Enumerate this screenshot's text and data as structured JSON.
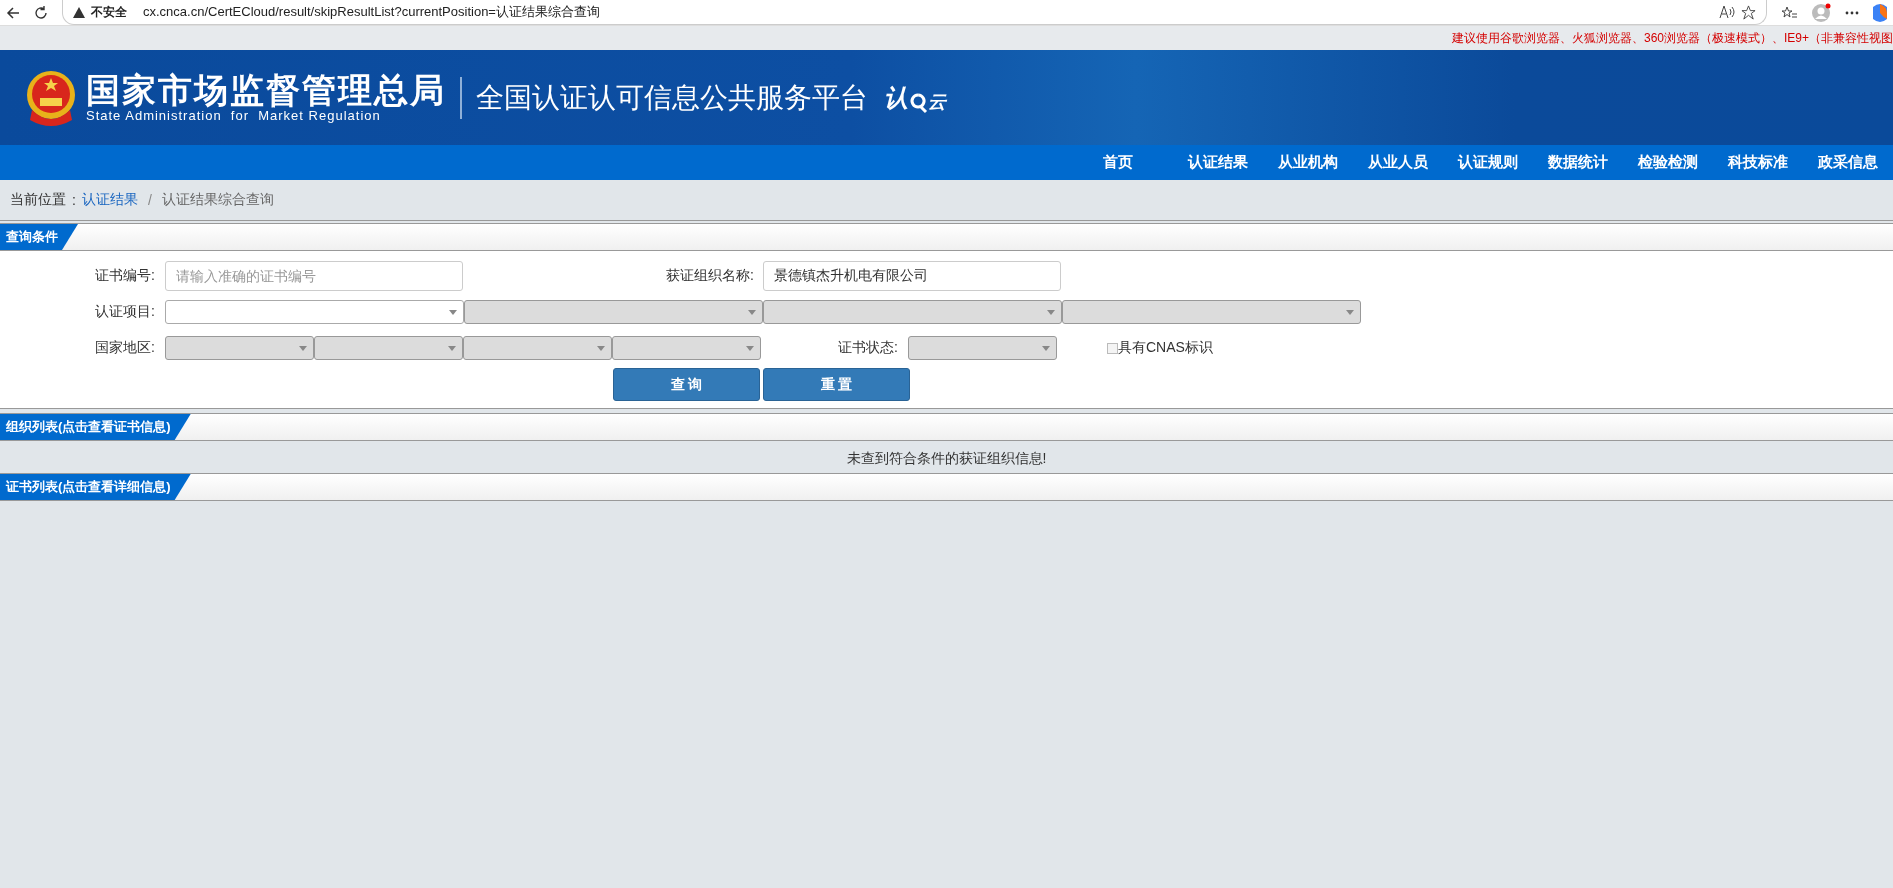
{
  "browser": {
    "security": "不安全",
    "url": "cx.cnca.cn/CertECloud/result/skipResultList?currentPosition=认证结果综合查询"
  },
  "notice": "建议使用谷歌浏览器、火狐浏览器、360浏览器（极速模式）、IE9+（非兼容性视图",
  "header": {
    "org_cn": "国家市场监督管理总局",
    "org_en": "State Administration  for  Market Regulation",
    "platform": "全国认证认可信息公共服务平台",
    "logo_parts": [
      "认",
      "云"
    ]
  },
  "nav": [
    "首页",
    "认证结果",
    "从业机构",
    "从业人员",
    "认证规则",
    "数据统计",
    "检验检测",
    "科技标准",
    "政采信息"
  ],
  "breadcrumb": {
    "label": "当前位置",
    "separator": ":",
    "link": "认证结果",
    "divider": "/",
    "current": "认证结果综合查询"
  },
  "query": {
    "title": "查询条件",
    "cert_no": {
      "label": "证书编号:",
      "placeholder": "请输入准确的证书编号"
    },
    "org_name": {
      "label": "获证组织名称:",
      "value": "景德镇杰升机电有限公司"
    },
    "project": {
      "label": "认证项目:",
      "selects": [
        {
          "disabled": false
        },
        {
          "disabled": true
        },
        {
          "disabled": true
        },
        {
          "disabled": true
        }
      ]
    },
    "region": {
      "label": "国家地区:",
      "selects": [
        {
          "disabled": true
        },
        {
          "disabled": true
        },
        {
          "disabled": true
        },
        {
          "disabled": true
        }
      ]
    },
    "status": {
      "label": "证书状态:",
      "disabled": true
    },
    "cnas": {
      "label": "具有CNAS标识",
      "checked": false
    },
    "buttons": [
      "查 询",
      "重 置"
    ]
  },
  "org_list": {
    "title": "组织列表(点击查看证书信息)",
    "message": "未查到符合条件的获证组织信息!"
  },
  "cert_list": {
    "title": "证书列表(点击查看详细信息)"
  }
}
